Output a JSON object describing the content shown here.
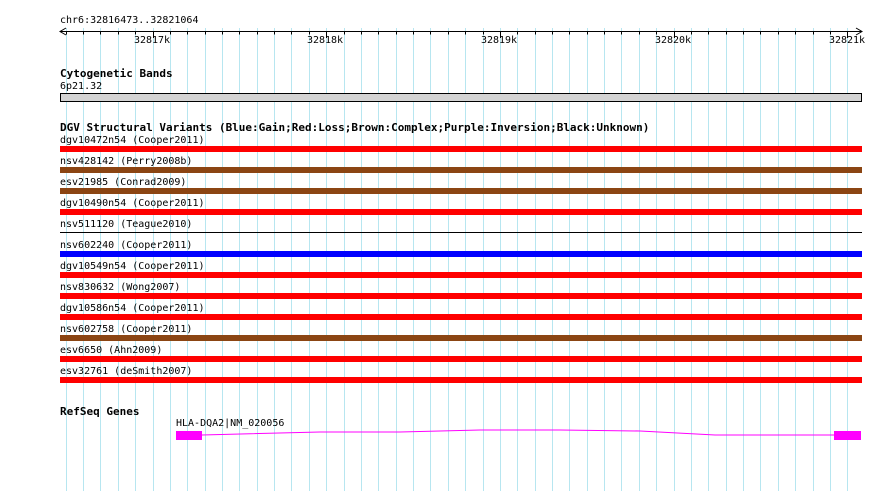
{
  "ruler": {
    "range_label": "chr6:32816473..32821064",
    "tick_labels": [
      "32817k",
      "32818k",
      "32819k",
      "32820k",
      "32821k"
    ]
  },
  "cytoband": {
    "title": "Cytogenetic Bands",
    "band_label": "6p21.32"
  },
  "dgv": {
    "title": "DGV Structural Variants (Blue:Gain;Red:Loss;Brown:Complex;Purple:Inversion;Black:Unknown)",
    "colors": {
      "gain": "#0000ff",
      "loss": "#ff0000",
      "complex": "#8b4513",
      "inversion": "#800080",
      "unknown": "#000000"
    },
    "variants": [
      {
        "label": "dgv10472n54 (Cooper2011)",
        "type": "loss"
      },
      {
        "label": "nsv428142 (Perry2008b)",
        "type": "complex"
      },
      {
        "label": "esv21985 (Conrad2009)",
        "type": "complex"
      },
      {
        "label": "dgv10490n54 (Cooper2011)",
        "type": "loss"
      },
      {
        "label": "nsv511120 (Teague2010)",
        "type": "unknown"
      },
      {
        "label": "nsv602240 (Cooper2011)",
        "type": "gain"
      },
      {
        "label": "dgv10549n54 (Cooper2011)",
        "type": "loss"
      },
      {
        "label": "nsv830632 (Wong2007)",
        "type": "loss"
      },
      {
        "label": "dgv10586n54 (Cooper2011)",
        "type": "loss"
      },
      {
        "label": "nsv602758 (Cooper2011)",
        "type": "complex"
      },
      {
        "label": "esv6650 (Ahn2009)",
        "type": "loss"
      },
      {
        "label": "esv32761 (deSmith2007)",
        "type": "loss"
      }
    ]
  },
  "refseq": {
    "title": "RefSeq Genes",
    "gene_label": "HLA-DQA2|NM_020056",
    "color": "#ff00ff"
  }
}
